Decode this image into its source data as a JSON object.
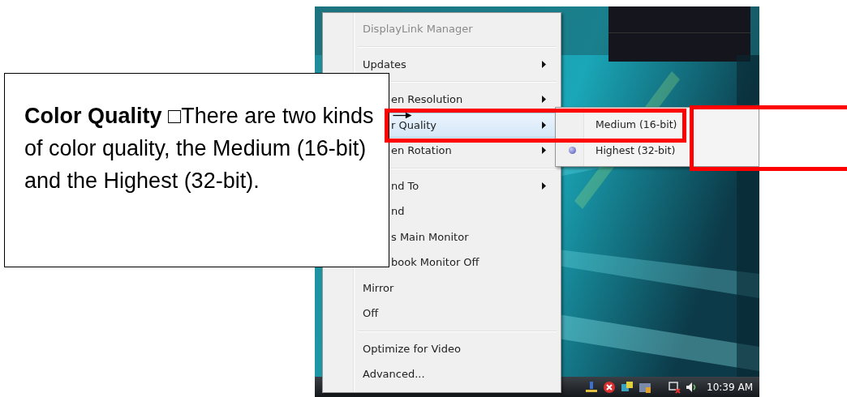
{
  "menu": {
    "items": [
      {
        "kind": "item",
        "label": "DisplayLink Manager",
        "disabled": true,
        "submenu": false,
        "selected": false
      },
      {
        "kind": "separator"
      },
      {
        "kind": "item",
        "label": "Updates",
        "disabled": false,
        "submenu": true,
        "selected": false
      },
      {
        "kind": "separator"
      },
      {
        "kind": "item",
        "label": "en Resolution",
        "disabled": false,
        "submenu": true,
        "selected": false
      },
      {
        "kind": "item",
        "label": "r Quality",
        "disabled": false,
        "submenu": true,
        "selected": true
      },
      {
        "kind": "item",
        "label": "en Rotation",
        "disabled": false,
        "submenu": true,
        "selected": false
      },
      {
        "kind": "separator"
      },
      {
        "kind": "item",
        "label": "nd To",
        "disabled": false,
        "submenu": true,
        "selected": false
      },
      {
        "kind": "item",
        "label": "nd",
        "disabled": false,
        "submenu": false,
        "selected": false
      },
      {
        "kind": "item",
        "label": "s Main Monitor",
        "disabled": false,
        "submenu": false,
        "selected": false
      },
      {
        "kind": "item",
        "label": "book Monitor Off",
        "disabled": false,
        "submenu": false,
        "selected": false
      },
      {
        "kind": "item",
        "label": "Mirror",
        "disabled": false,
        "submenu": false,
        "selected": false
      },
      {
        "kind": "item",
        "label": "Off",
        "disabled": false,
        "submenu": false,
        "selected": false
      },
      {
        "kind": "separator"
      },
      {
        "kind": "item",
        "label": "Optimize for Video",
        "disabled": false,
        "submenu": false,
        "selected": false
      },
      {
        "kind": "item",
        "label": "Advanced...",
        "disabled": false,
        "submenu": false,
        "selected": false
      }
    ]
  },
  "submenu": {
    "items": [
      {
        "label": "Medium (16-bit)",
        "checked": false
      },
      {
        "label": "Highest (32-bit)",
        "checked": true
      }
    ]
  },
  "taskbar": {
    "clock": "10:39 AM"
  },
  "callout": {
    "text": "**Color Quality**  □There are two kinds of color quality, the Medium (16-bit) and the Highest (32-bit)."
  }
}
